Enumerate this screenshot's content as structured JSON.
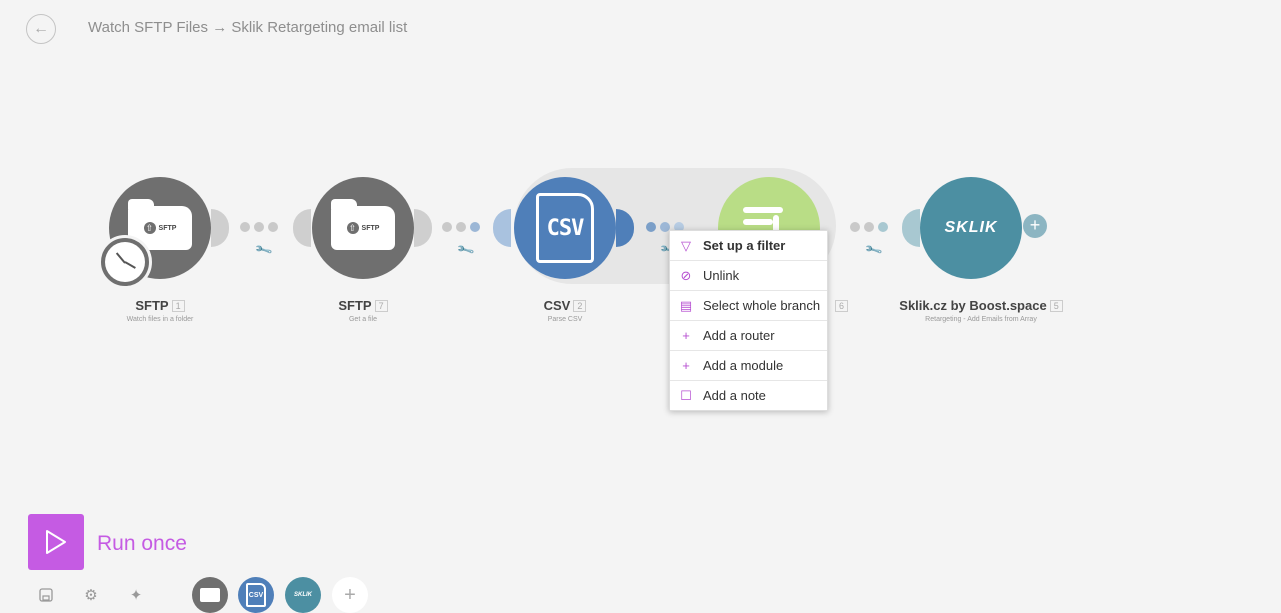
{
  "header": {
    "back_icon": "arrow-left-icon",
    "title": "Watch SFTP Files → Sklik Retargeting email list"
  },
  "modules": [
    {
      "name": "SFTP",
      "number": "1",
      "subtitle": "Watch files in a folder",
      "icon": "sftp-folder-icon",
      "badge": "SFTP",
      "color": "#6f6f6f"
    },
    {
      "name": "SFTP",
      "number": "7",
      "subtitle": "Get a file",
      "icon": "sftp-folder-icon",
      "badge": "SFTP",
      "color": "#6f6f6f"
    },
    {
      "name": "CSV",
      "number": "2",
      "subtitle": "Parse CSV",
      "icon": "csv-file-icon",
      "badge": "CSV",
      "color": "#4f7fb9"
    },
    {
      "name": "",
      "number": "6",
      "subtitle": "",
      "icon": "json-transform-icon",
      "color": "#b9dd86"
    },
    {
      "name": "Sklik.cz by Boost.space",
      "number": "5",
      "subtitle": "Retargeting - Add Emails from Array",
      "icon": "sklik-logo-icon",
      "badge": "SKLIK",
      "color": "#4c8fa2"
    }
  ],
  "context_menu": {
    "items": [
      {
        "label": "Set up a filter",
        "icon": "filter-icon"
      },
      {
        "label": "Unlink",
        "icon": "unlink-icon"
      },
      {
        "label": "Select whole branch",
        "icon": "select-branch-icon"
      },
      {
        "label": "Add a router",
        "icon": "plus-icon"
      },
      {
        "label": "Add a module",
        "icon": "plus-icon"
      },
      {
        "label": "Add a note",
        "icon": "note-icon"
      }
    ]
  },
  "footer": {
    "run_label": "Run once",
    "toolbar": [
      "save-icon",
      "gear-icon",
      "magic-wand-icon"
    ],
    "favorites": [
      {
        "label": "SFTP",
        "color": "#6f6f6f"
      },
      {
        "label": "CSV",
        "color": "#4f7fb9"
      },
      {
        "label": "SKLIK",
        "color": "#4c8fa2"
      }
    ],
    "add_icon": "plus-icon"
  },
  "colors": {
    "accent": "#c55be3",
    "canvas_bg": "#f4f4f4",
    "dot_gray": "#c9c9c9",
    "dot_blue": "#9cb7d6",
    "dot_teal": "#a8c8d1"
  }
}
